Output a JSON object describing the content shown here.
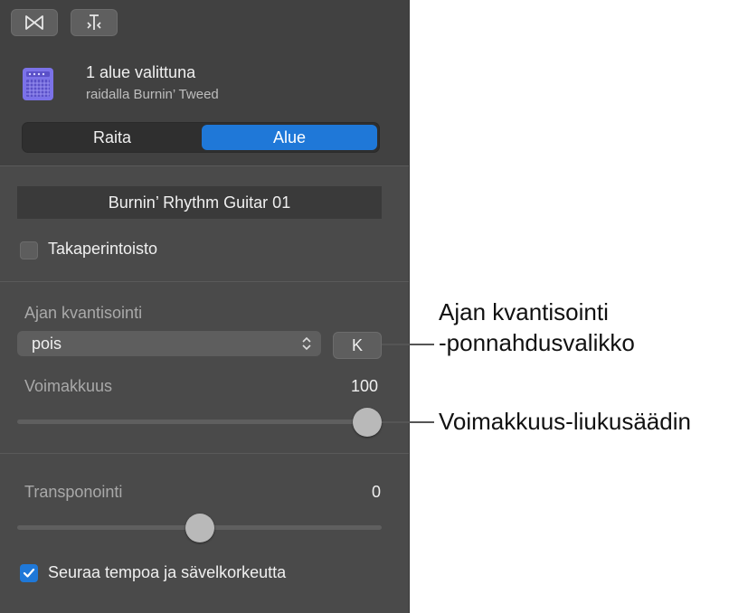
{
  "toolbar": {
    "left_button_icon": "bowtie-smart-controls-icon",
    "right_button_icon": "editor-scissors-icon"
  },
  "header": {
    "icon": "amp-icon",
    "title": "1 alue valittuna",
    "subtitle": "raidalla Burnin’ Tweed"
  },
  "tabs": [
    {
      "label": "Raita",
      "selected": false
    },
    {
      "label": "Alue",
      "selected": true
    }
  ],
  "region": {
    "name": "Burnin’ Rhythm Guitar 01",
    "reverse_label": "Takaperintoisto",
    "reverse_checked": false
  },
  "quantize": {
    "label": "Ajan kvantisointi",
    "value": "pois",
    "button_label": "K"
  },
  "velocity": {
    "label": "Voimakkuus",
    "value": "100",
    "level": 1.0
  },
  "transpose": {
    "label": "Transponointi",
    "value": "0",
    "level": 0.5
  },
  "follow": {
    "label": "Seuraa tempoa ja sävelkorkeutta",
    "checked": true
  },
  "callouts": {
    "quantize_line1": "Ajan kvantisointi",
    "quantize_line2": "-ponnahdusvalikko",
    "velocity": "Voimakkuus-liukusäädin"
  },
  "colors": {
    "accent": "#1f78d8",
    "amp_icon": "#7b72e8"
  }
}
